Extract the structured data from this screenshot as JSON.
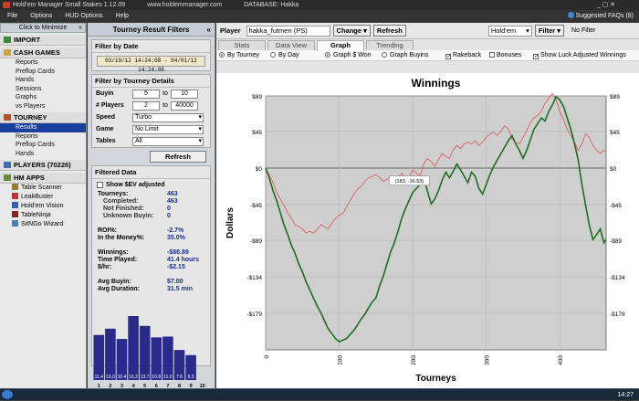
{
  "titlebar": {
    "app": "Hold'em Manager Small Stakes 1.12.09",
    "url": "www.holdemmanager.com",
    "db": "DATABASE: Hakka"
  },
  "menu": [
    "File",
    "Options",
    "HUD Options",
    "Help"
  ],
  "faq": "Suggested FAQs (8)",
  "sidebar": {
    "minimize": "Click to Minimize",
    "import": "IMPORT",
    "cash": {
      "title": "CASH GAMES",
      "items": [
        "Reports",
        "Preflop Cards",
        "Hands",
        "Sessions",
        "Graphs",
        "vs Players"
      ]
    },
    "tourney": {
      "title": "TOURNEY",
      "items": [
        "Results",
        "Reports",
        "Preflop Cards",
        "Hands"
      ]
    },
    "players": "PLAYERS (70226)",
    "apps": {
      "title": "HM APPS",
      "items": [
        "Table Scanner",
        "LeakBuster",
        "Hold'em Vision",
        "TableNinja",
        "SitNGo Wizard"
      ]
    }
  },
  "filters": {
    "title": "Tourney Result Filters",
    "date_title": "Filter by Date",
    "date_range": "03/19/12 14:24:08 - 04/01/12 14:24:08",
    "details_title": "Filter by Tourney Details",
    "buyin_label": "Buyin",
    "buyin_from": "5",
    "buyin_to": "10",
    "players_label": "# Players",
    "players_from": "2",
    "players_to": "40000",
    "to": "to",
    "speed_label": "Speed",
    "speed_value": "Turbo",
    "game_label": "Game",
    "game_value": "No Limit",
    "tables_label": "Tables",
    "tables_value": "All",
    "refresh": "Refresh"
  },
  "filtered": {
    "title": "Filtered Data",
    "ev_label": "Show $EV adjusted",
    "stats": [
      {
        "k": "Tourneys:",
        "v": "463",
        "ind": false
      },
      {
        "k": "Completed:",
        "v": "463",
        "ind": true
      },
      {
        "k": "Not Finished:",
        "v": "0",
        "ind": true
      },
      {
        "k": "Unknown Buyin:",
        "v": "0",
        "ind": true
      },
      {
        "k": "",
        "v": "",
        "ind": false
      },
      {
        "k": "ROI%:",
        "v": "-2.7%",
        "ind": false
      },
      {
        "k": "In the Money%:",
        "v": "35.0%",
        "ind": false
      },
      {
        "k": "",
        "v": "",
        "ind": false
      },
      {
        "k": "Winnings:",
        "v": "-$88.89",
        "ind": false
      },
      {
        "k": "Time Played:",
        "v": "41.4 hours",
        "ind": false
      },
      {
        "k": "$/hr:",
        "v": "-$2.15",
        "ind": false
      },
      {
        "k": "",
        "v": "",
        "ind": false
      },
      {
        "k": "Avg Buyin:",
        "v": "$7.00",
        "ind": false
      },
      {
        "k": "Avg Duration:",
        "v": "31.5 min",
        "ind": false
      }
    ],
    "histogram": {
      "bins": [
        "1",
        "2",
        "3",
        "4",
        "5",
        "6",
        "7",
        "8",
        "9",
        "10"
      ],
      "values": [
        11.4,
        13.0,
        10.4,
        16.2,
        13.7,
        10.8,
        11.0,
        7.6,
        6.3,
        0
      ],
      "labels": [
        "11.4",
        "13.0",
        "10.4",
        "16.2",
        "13.7",
        "10.8",
        "11.0",
        "7.6",
        "6.3",
        ""
      ],
      "color": "#2a2a8a"
    }
  },
  "toolbar": {
    "player_label": "Player",
    "player": "hakka_futmen (PS)",
    "change": "Change",
    "refresh": "Refresh",
    "game": "Hold'em",
    "filter": "Filter",
    "filter_status": "No Filter"
  },
  "tabs": [
    "Stats",
    "Data View",
    "Graph",
    "Trending"
  ],
  "active_tab": "Graph",
  "options": {
    "by_tourney": "By Tourney",
    "by_day": "By Day",
    "won": "Graph $ Won",
    "buyins": "Graph Buyins",
    "rakeback": "Rakeback",
    "bonuses": "Bonuses",
    "luck": "Show Luck Adjusted Winnings"
  },
  "chart_data": {
    "type": "line",
    "title": "Winnings",
    "xlabel": "Tourneys",
    "ylabel": "Dollars",
    "xlim": [
      0,
      463
    ],
    "ylim": [
      -224,
      89
    ],
    "yticks": [
      89,
      45,
      0,
      -45,
      -89,
      -134,
      -179
    ],
    "ytick_labels": [
      "$89",
      "$45",
      "$0",
      "-$45",
      "-$89",
      "-$134",
      "-$179"
    ],
    "xticks": [
      0,
      100,
      200,
      300,
      400
    ],
    "tooltip": "(183, -16.53)",
    "grid": true,
    "series": [
      {
        "color": "#1f6e1f",
        "x": [
          0,
          5,
          10,
          15,
          20,
          25,
          30,
          35,
          40,
          45,
          50,
          55,
          60,
          65,
          70,
          75,
          80,
          85,
          90,
          95,
          100,
          105,
          110,
          115,
          120,
          125,
          130,
          135,
          140,
          145,
          150,
          155,
          160,
          165,
          170,
          175,
          180,
          185,
          190,
          195,
          200,
          205,
          210,
          215,
          220,
          225,
          230,
          235,
          240,
          245,
          250,
          255,
          260,
          265,
          270,
          275,
          280,
          285,
          290,
          295,
          300,
          305,
          310,
          315,
          320,
          325,
          330,
          335,
          340,
          345,
          350,
          355,
          360,
          365,
          370,
          375,
          380,
          385,
          390,
          395,
          400,
          405,
          410,
          415,
          420,
          425,
          430,
          435,
          440,
          445,
          450,
          455,
          460,
          463
        ],
        "y": [
          0,
          -12,
          -28,
          -40,
          -55,
          -70,
          -82,
          -95,
          -105,
          -118,
          -128,
          -140,
          -150,
          -160,
          -170,
          -178,
          -188,
          -198,
          -204,
          -210,
          -214,
          -212,
          -210,
          -205,
          -200,
          -193,
          -186,
          -180,
          -172,
          -165,
          -160,
          -145,
          -133,
          -118,
          -103,
          -92,
          -78,
          -62,
          -50,
          -40,
          -30,
          -25,
          -20,
          -12,
          -28,
          -44,
          -38,
          -28,
          -15,
          -5,
          -12,
          -4,
          5,
          -2,
          -10,
          -18,
          -5,
          -10,
          -25,
          -32,
          -20,
          -8,
          2,
          10,
          18,
          26,
          34,
          40,
          30,
          22,
          12,
          22,
          35,
          48,
          55,
          62,
          58,
          70,
          78,
          88,
          84,
          76,
          62,
          48,
          30,
          10,
          -20,
          -45,
          -70,
          -88,
          -82,
          -75,
          -92,
          -88
        ]
      },
      {
        "color": "#e06060",
        "x": [
          0,
          5,
          10,
          15,
          20,
          25,
          30,
          35,
          40,
          45,
          50,
          55,
          60,
          65,
          70,
          75,
          80,
          85,
          90,
          95,
          100,
          105,
          110,
          115,
          120,
          125,
          130,
          135,
          140,
          145,
          150,
          155,
          160,
          165,
          170,
          175,
          180,
          185,
          190,
          195,
          200,
          205,
          210,
          215,
          220,
          225,
          230,
          235,
          240,
          245,
          250,
          255,
          260,
          265,
          270,
          275,
          280,
          285,
          290,
          295,
          300,
          305,
          310,
          315,
          320,
          325,
          330,
          335,
          340,
          345,
          350,
          355,
          360,
          365,
          370,
          375,
          380,
          385,
          390,
          395,
          400,
          405,
          410,
          415,
          420,
          425,
          430,
          435,
          440,
          445,
          450,
          455,
          460,
          463
        ],
        "y": [
          0,
          -8,
          -18,
          -30,
          -38,
          -46,
          -55,
          -62,
          -70,
          -72,
          -75,
          -80,
          -78,
          -80,
          -76,
          -70,
          -72,
          -75,
          -68,
          -62,
          -58,
          -56,
          -48,
          -40,
          -32,
          -26,
          -22,
          -16,
          -12,
          -10,
          -8,
          -12,
          -16,
          -14,
          -10,
          -16,
          -14,
          -6,
          -14,
          -12,
          -2,
          -6,
          -10,
          5,
          12,
          8,
          2,
          10,
          18,
          14,
          12,
          22,
          28,
          24,
          30,
          32,
          30,
          34,
          28,
          32,
          38,
          42,
          44,
          40,
          46,
          52,
          48,
          36,
          32,
          30,
          38,
          46,
          56,
          62,
          65,
          70,
          80,
          86,
          92,
          84,
          70,
          60,
          48,
          40,
          32,
          22,
          30,
          42,
          38,
          28,
          22,
          18,
          22,
          20
        ]
      }
    ]
  }
}
